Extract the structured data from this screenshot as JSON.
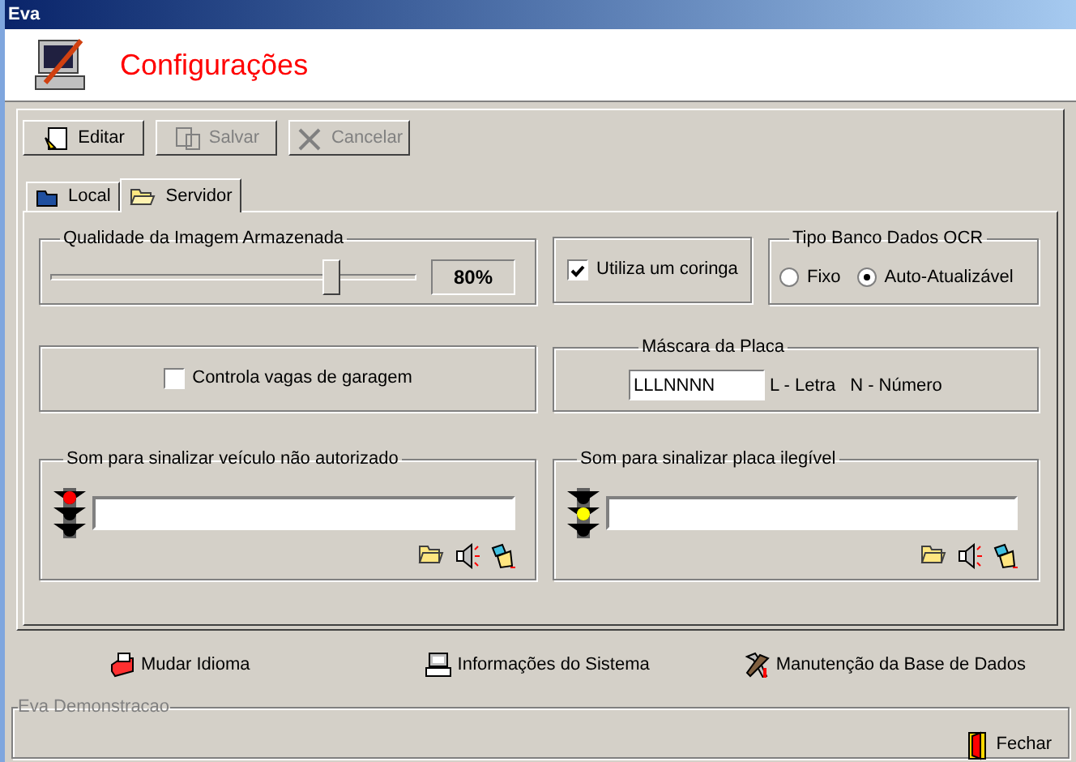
{
  "window": {
    "title": "Eva"
  },
  "header": {
    "title": "Configurações"
  },
  "toolbar": [
    {
      "label": "Editar",
      "disabled": false,
      "kind": "edit"
    },
    {
      "label": "Salvar",
      "disabled": true,
      "kind": "save"
    },
    {
      "label": "Cancelar",
      "disabled": true,
      "kind": "cancel"
    }
  ],
  "tabs": [
    {
      "label": "Local",
      "selected": false
    },
    {
      "label": "Servidor",
      "selected": true
    }
  ],
  "quality": {
    "label": "Qualidade da Imagem Armazenada",
    "level": 0.78,
    "reading": "80%"
  },
  "wildcard": {
    "label": "Utiliza um coringa",
    "checked": true
  },
  "ocr_db": {
    "label": "Tipo Banco Dados OCR",
    "options": [
      {
        "label": "Fixo",
        "selected": false
      },
      {
        "label": "Auto-Atualizável",
        "selected": true
      }
    ]
  },
  "garage": {
    "label": "Controla vagas de garagem",
    "checked": false
  },
  "plate_mask": {
    "label": "Máscara da Placa",
    "value": "LLLNNNN",
    "legend": [
      "L - Letra",
      "N - Número"
    ]
  },
  "sounds": [
    {
      "label": "Som para sinalizar veículo não autorizado",
      "kind": "top",
      "color": "#ff0000"
    },
    {
      "label": "Som para sinalizar placa ilegível",
      "kind": "middle",
      "color": "#ffff00"
    }
  ],
  "links": [
    {
      "label": "Mudar Idioma",
      "kind": "language"
    },
    {
      "label": "Informações do Sistema",
      "kind": "info"
    },
    {
      "label": "Manutenção da Base de Dados",
      "kind": "tools"
    }
  ],
  "footer": {
    "legend": "Eva Demonstracao",
    "close": "Fechar"
  }
}
